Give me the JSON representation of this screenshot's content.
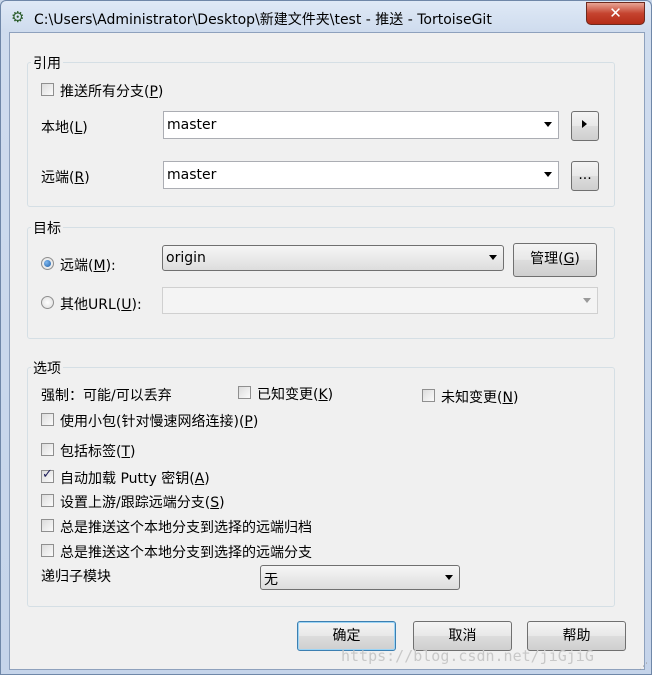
{
  "window": {
    "title": "C:\\Users\\Administrator\\Desktop\\新建文件夹\\test - 推送 - TortoiseGit",
    "close_glyph": "✕"
  },
  "ref_group": {
    "title": "引用",
    "push_all_label": "推送所有分支",
    "push_all_key": "P",
    "local_label": "本地",
    "local_key": "L",
    "local_value": "master",
    "remote_label": "远端",
    "remote_key": "R",
    "remote_value": "master",
    "browse_label": "..."
  },
  "target_group": {
    "title": "目标",
    "remote_radio_label": "远端",
    "remote_radio_key": "M",
    "remote_value": "origin",
    "manage_label": "管理",
    "manage_key": "G",
    "other_url_label": "其他URL",
    "other_url_key": "U",
    "other_url_value": ""
  },
  "options_group": {
    "title": "选项",
    "force_label": "强制：可能/可以丢弃",
    "known_changes_label": "已知变更",
    "known_changes_key": "K",
    "unknown_changes_label": "未知变更",
    "unknown_changes_key": "N",
    "thin_pack_label": "使用小包(针对慢速网络连接)",
    "thin_pack_key": "P",
    "include_tags_label": "包括标签",
    "include_tags_key": "T",
    "autoload_putty_label": "自动加载 Putty 密钥",
    "autoload_putty_key": "A",
    "set_upstream_label": "设置上游/跟踪远端分支",
    "set_upstream_key": "S",
    "always_push_archive_label": "总是推送这个本地分支到选择的远端归档",
    "always_push_branch_label": "总是推送这个本地分支到选择的远端分支",
    "recurse_submodules_label": "递归子模块",
    "recurse_submodules_value": "无"
  },
  "footer": {
    "ok_label": "确定",
    "cancel_label": "取消",
    "help_label": "帮助",
    "watermark": "https://blog.csdn.net/jiGjiG"
  },
  "state": {
    "push_all": false,
    "remote_radio_selected": true,
    "known_changes": false,
    "unknown_changes": false,
    "thin_pack": false,
    "include_tags": false,
    "autoload_putty": true,
    "set_upstream": false,
    "always_push_archive": false,
    "always_push_branch": false
  }
}
